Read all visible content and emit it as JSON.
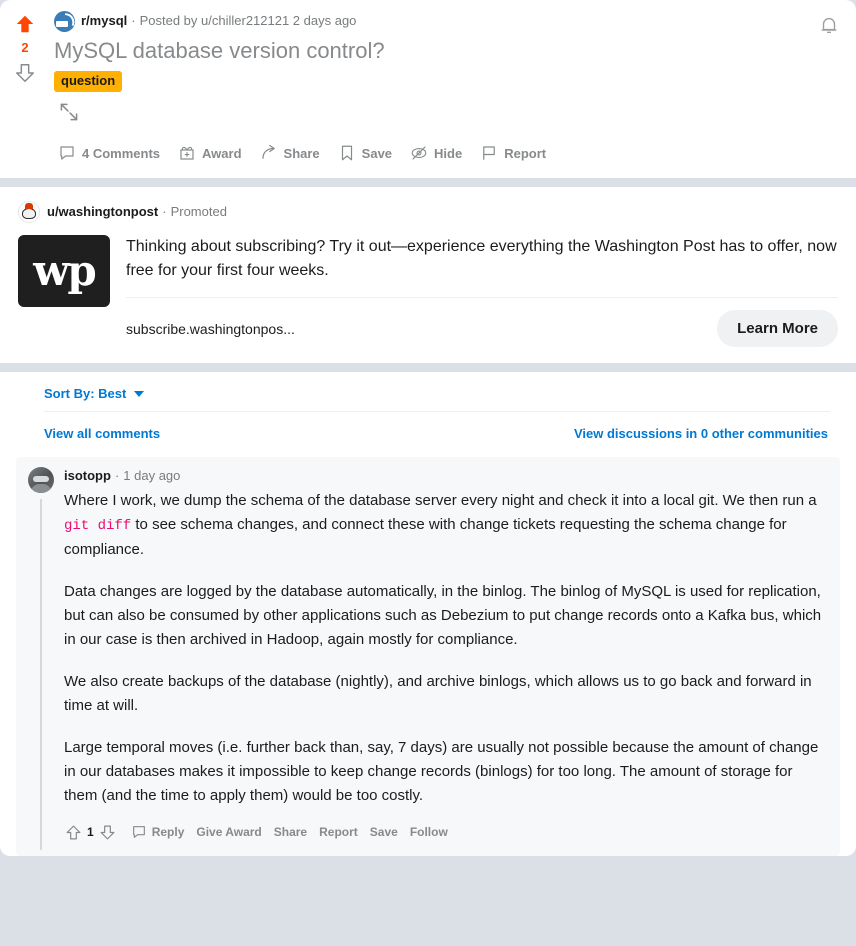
{
  "post": {
    "vote": {
      "score": "2",
      "upvote_icon": "arrow-up-filled",
      "downvote_icon": "arrow-down-outline",
      "upvoted_color": "#ff4500"
    },
    "subreddit": "r/mysql",
    "meta_separator": "·",
    "posted_by": "Posted by u/chiller212121 2 days ago",
    "title": "MySQL database version control?",
    "flair": "question",
    "expand_icon": "expand-arrows-icon",
    "actions": [
      {
        "label": "4 Comments",
        "icon": "comment-bubble-icon"
      },
      {
        "label": "Award",
        "icon": "gift-icon"
      },
      {
        "label": "Share",
        "icon": "share-arrow-icon"
      },
      {
        "label": "Save",
        "icon": "bookmark-icon"
      },
      {
        "label": "Hide",
        "icon": "eye-slash-icon"
      },
      {
        "label": "Report",
        "icon": "flag-icon"
      }
    ],
    "bell_icon": "notification-bell-icon"
  },
  "ad": {
    "avatar_icon": "washingtonpost-avatar",
    "username": "u/washingtonpost",
    "separator": "·",
    "promoted_label": "Promoted",
    "logo_text": "wp",
    "body": "Thinking about subscribing? Try it out—experience everything the Washington Post has to offer, now free for your first four weeks.",
    "url": "subscribe.washingtonpos...",
    "cta_label": "Learn More"
  },
  "comments_header": {
    "sort_label": "Sort By: Best",
    "sort_caret_icon": "chevron-down-icon",
    "view_all_label": "View all comments",
    "other_communities_label": "View discussions in 0 other communities"
  },
  "comment": {
    "avatar_icon": "user-avatar",
    "username": "isotopp",
    "separator": "·",
    "timestamp": "1 day ago",
    "paragraphs": [
      {
        "before": "Where I work, we dump the schema of the database server every night and check it into a local git. We then run a ",
        "code": "git diff",
        "after": " to see schema changes, and connect these with change tickets requesting the schema change for compliance."
      },
      {
        "text": "Data changes are logged by the database automatically, in the binlog. The binlog of MySQL is used for replication, but can also be consumed by other applications such as Debezium to put change records onto a Kafka bus, which in our case is then archived in Hadoop, again mostly for compliance."
      },
      {
        "text": "We also create backups of the database (nightly), and archive binlogs, which allows us to go back and forward in time at will."
      },
      {
        "text": "Large temporal moves (i.e. further back than, say, 7 days) are usually not possible because the amount of change in our databases makes it impossible to keep change records (binlogs) for too long. The amount of storage for them (and the time to apply them) would be too costly."
      }
    ],
    "score": "1",
    "upvote_icon": "arrow-up-outline",
    "downvote_icon": "arrow-down-outline",
    "actions": [
      {
        "label": "Reply",
        "icon": "comment-bubble-icon"
      },
      {
        "label": "Give Award",
        "icon": ""
      },
      {
        "label": "Share",
        "icon": ""
      },
      {
        "label": "Report",
        "icon": ""
      },
      {
        "label": "Save",
        "icon": ""
      },
      {
        "label": "Follow",
        "icon": ""
      }
    ]
  },
  "colors": {
    "page_bg": "#dae0e6",
    "upvote_orange": "#ff4500",
    "link_blue": "#0079d3",
    "flair_bg": "#ffb000",
    "code_pink": "#ea0e72",
    "comment_bg": "#f6f8fa"
  }
}
